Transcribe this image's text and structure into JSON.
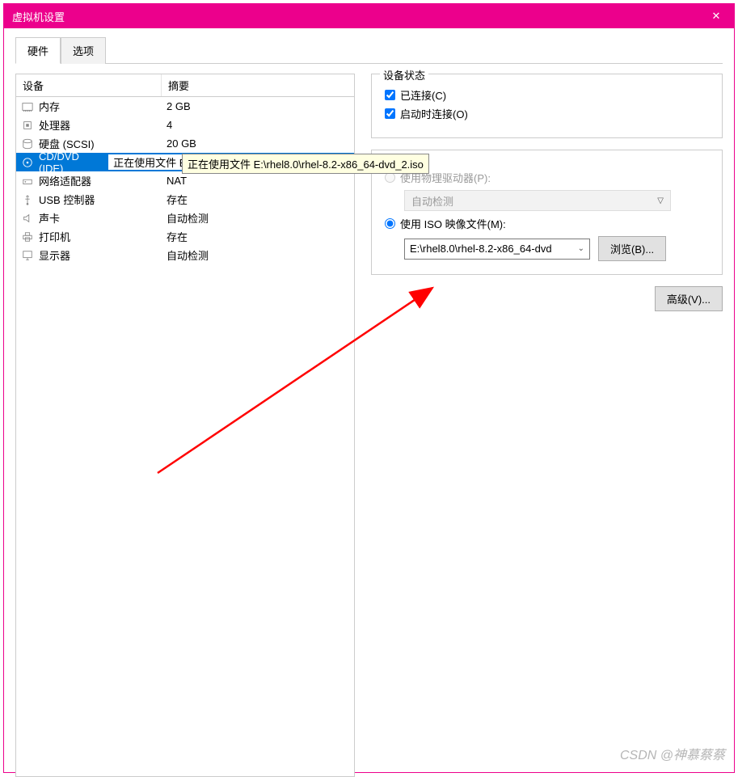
{
  "window": {
    "title": "虚拟机设置"
  },
  "tabs": [
    {
      "label": "硬件",
      "active": true
    },
    {
      "label": "选项",
      "active": false
    }
  ],
  "device_list": {
    "headers": {
      "device": "设备",
      "summary": "摘要"
    },
    "rows": [
      {
        "icon": "memory-icon",
        "name": "内存",
        "summary": "2 GB"
      },
      {
        "icon": "cpu-icon",
        "name": "处理器",
        "summary": "4"
      },
      {
        "icon": "harddisk-icon",
        "name": "硬盘 (SCSI)",
        "summary": "20 GB"
      },
      {
        "icon": "cd-icon",
        "name": "CD/DVD (IDE)",
        "summary": "正在使用文件 E:\\rhel8.0\\rhel-8.2-x86_64-dvd_2.iso",
        "selected": true
      },
      {
        "icon": "network-icon",
        "name": "网络适配器",
        "summary": "NAT"
      },
      {
        "icon": "usb-icon",
        "name": "USB 控制器",
        "summary": "存在"
      },
      {
        "icon": "sound-icon",
        "name": "声卡",
        "summary": "自动检测"
      },
      {
        "icon": "printer-icon",
        "name": "打印机",
        "summary": "存在"
      },
      {
        "icon": "display-icon",
        "name": "显示器",
        "summary": "自动检测"
      }
    ]
  },
  "details": {
    "status": {
      "title": "设备状态",
      "connected": "已连接(C)",
      "connect_at_poweron": "启动时连接(O)",
      "connected_checked": true,
      "connect_at_poweron_checked": true
    },
    "connection": {
      "physical_label": "使用物理驱动器(P):",
      "physical_value": "自动检测",
      "physical_enabled": false,
      "iso_label": "使用 ISO 映像文件(M):",
      "iso_value": "E:\\rhel8.0\\rhel-8.2-x86_64-dvd",
      "iso_selected": true,
      "browse": "浏览(B)..."
    },
    "advanced": "高级(V)..."
  },
  "tooltip": {
    "text": "正在使用文件 E:\\rhel8.0\\rhel-8.2-x86_64-dvd_2.iso"
  },
  "colors": {
    "accent": "#ec008c",
    "selection": "#0078d7",
    "annotation": "#ff0000"
  },
  "watermark": "CSDN @神慕蔡蔡"
}
